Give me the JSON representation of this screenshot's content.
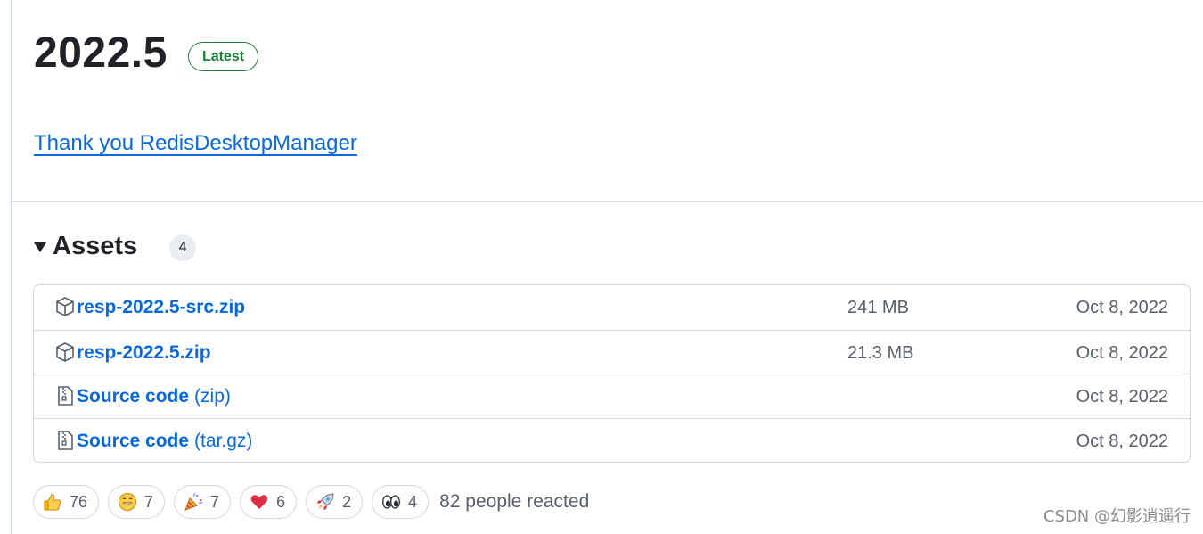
{
  "release": {
    "title": "2022.5",
    "badge": "Latest",
    "note_link": "Thank you RedisDesktopManager"
  },
  "assets": {
    "title": "Assets",
    "count": "4",
    "rows": [
      {
        "name": "resp-2022.5-src.zip",
        "suffix": "",
        "size": "241 MB",
        "date": "Oct 8, 2022",
        "icon": "package-icon"
      },
      {
        "name": "resp-2022.5.zip",
        "suffix": "",
        "size": "21.3 MB",
        "date": "Oct 8, 2022",
        "icon": "package-icon"
      },
      {
        "name": "Source code",
        "suffix": "(zip)",
        "size": "",
        "date": "Oct 8, 2022",
        "icon": "file-zip-icon"
      },
      {
        "name": "Source code",
        "suffix": "(tar.gz)",
        "size": "",
        "date": "Oct 8, 2022",
        "icon": "file-zip-icon"
      }
    ]
  },
  "reactions": {
    "items": [
      {
        "emoji": "thumbs-up-icon",
        "count": "76"
      },
      {
        "emoji": "smile-icon",
        "count": "7"
      },
      {
        "emoji": "party-popper-icon",
        "count": "7"
      },
      {
        "emoji": "heart-icon",
        "count": "6"
      },
      {
        "emoji": "rocket-icon",
        "count": "2"
      },
      {
        "emoji": "eyes-icon",
        "count": "4"
      }
    ],
    "summary": "82 people reacted"
  },
  "watermark": "CSDN @幻影逍遥行",
  "colors": {
    "link": "#0969da",
    "latest_green": "#1a7f37",
    "border": "#d0d7de",
    "muted": "#57606a"
  }
}
